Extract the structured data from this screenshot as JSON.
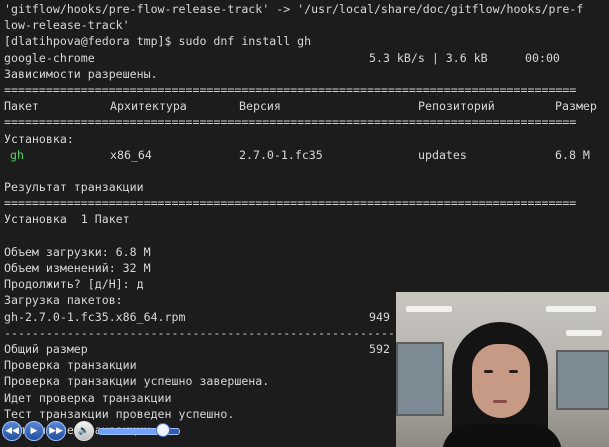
{
  "terminal": {
    "lines": [
      "'gitflow/hooks/pre-flow-release-track' -> '/usr/local/share/doc/gitflow/hooks/pre-f",
      "low-release-track'",
      "[dlatihpova@fedora tmp]$ sudo dnf install gh",
      "google-chrome",
      "Зависимости разрешены.",
      "=================================================================================="
    ],
    "download": {
      "speed": "5.3 kB/s | 3.6 kB",
      "time": "00:00"
    },
    "table_header": {
      "package": "Пакет",
      "arch": "Архитектура",
      "version": "Версия",
      "repo": "Репозиторий",
      "size": "Размер"
    },
    "install_heading": "Установка:",
    "package_row": {
      "name": "gh",
      "arch": "x86_64",
      "version": "2.7.0-1.fc35",
      "repo": "updates",
      "size": "6.8 M"
    },
    "separator": "==================================================================================",
    "result_heading": "Результат транзакции",
    "install_count": "Установка  1 Пакет",
    "download_size": "Объем загрузки: 6.8 M",
    "change_size": "Объем изменений: 32 M",
    "continue_prompt": "Продолжить? [д/Н]: д",
    "loading_packages": "Загрузка пакетов:",
    "rpm_file": "gh-2.7.0-1.fc35.x86_64.rpm",
    "rpm_progress": "949",
    "dash_separator": "----------------------------------------------------------------------------------",
    "total_size_label": "Общий размер",
    "total_size_value": "592",
    "check_transaction": "Проверка транзакции",
    "check_done": "Проверка транзакции успешно завершена.",
    "check_running": "Идет проверка транзакции",
    "test_done": "Тест транзакции проведен успешно.",
    "bottom_partial": "Выполнение транзакции"
  },
  "media_controls": {
    "volume_level": 0.8,
    "accent_color": "#2a5cb8"
  }
}
